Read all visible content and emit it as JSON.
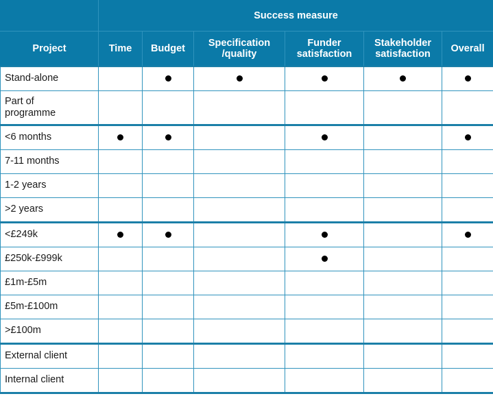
{
  "table": {
    "group_header": "Success measure",
    "columns": [
      {
        "key": "project",
        "label": "Project"
      },
      {
        "key": "time",
        "label": "Time"
      },
      {
        "key": "budget",
        "label": "Budget"
      },
      {
        "key": "spec",
        "label": "Specification\n/quality"
      },
      {
        "key": "funder",
        "label": "Funder\nsatisfaction"
      },
      {
        "key": "stakeholder",
        "label": "Stakeholder\nsatisfaction"
      },
      {
        "key": "overall",
        "label": "Overall"
      }
    ],
    "marker": "●",
    "colors": {
      "header_background": "#0b7aa8",
      "header_text": "#ffffff",
      "grid_line": "#2f93bd",
      "group_rule": "#1b7fa8",
      "marker": "#000000",
      "cell_background": "#ffffff"
    },
    "rows": [
      {
        "label": "Stand-alone",
        "group_start": false,
        "tall": false,
        "marks": {
          "time": false,
          "budget": true,
          "spec": true,
          "funder": true,
          "stakeholder": true,
          "overall": true
        }
      },
      {
        "label": "Part of\nprogramme",
        "group_start": false,
        "tall": true,
        "marks": {
          "time": false,
          "budget": false,
          "spec": false,
          "funder": false,
          "stakeholder": false,
          "overall": false
        }
      },
      {
        "label": "<6 months",
        "group_start": true,
        "tall": false,
        "marks": {
          "time": true,
          "budget": true,
          "spec": false,
          "funder": true,
          "stakeholder": false,
          "overall": true
        }
      },
      {
        "label": "7-11 months",
        "group_start": false,
        "tall": false,
        "marks": {
          "time": false,
          "budget": false,
          "spec": false,
          "funder": false,
          "stakeholder": false,
          "overall": false
        }
      },
      {
        "label": "1-2 years",
        "group_start": false,
        "tall": false,
        "marks": {
          "time": false,
          "budget": false,
          "spec": false,
          "funder": false,
          "stakeholder": false,
          "overall": false
        }
      },
      {
        "label": ">2 years",
        "group_start": false,
        "tall": false,
        "marks": {
          "time": false,
          "budget": false,
          "spec": false,
          "funder": false,
          "stakeholder": false,
          "overall": false
        }
      },
      {
        "label": "<£249k",
        "group_start": true,
        "tall": false,
        "marks": {
          "time": true,
          "budget": true,
          "spec": false,
          "funder": true,
          "stakeholder": false,
          "overall": true
        }
      },
      {
        "label": "£250k-£999k",
        "group_start": false,
        "tall": false,
        "marks": {
          "time": false,
          "budget": false,
          "spec": false,
          "funder": true,
          "stakeholder": false,
          "overall": false
        }
      },
      {
        "label": "£1m-£5m",
        "group_start": false,
        "tall": false,
        "marks": {
          "time": false,
          "budget": false,
          "spec": false,
          "funder": false,
          "stakeholder": false,
          "overall": false
        }
      },
      {
        "label": "£5m-£100m",
        "group_start": false,
        "tall": false,
        "marks": {
          "time": false,
          "budget": false,
          "spec": false,
          "funder": false,
          "stakeholder": false,
          "overall": false
        }
      },
      {
        "label": ">£100m",
        "group_start": false,
        "tall": false,
        "marks": {
          "time": false,
          "budget": false,
          "spec": false,
          "funder": false,
          "stakeholder": false,
          "overall": false
        }
      },
      {
        "label": "External client",
        "group_start": true,
        "tall": false,
        "marks": {
          "time": false,
          "budget": false,
          "spec": false,
          "funder": false,
          "stakeholder": false,
          "overall": false
        }
      },
      {
        "label": "Internal client",
        "group_start": false,
        "tall": false,
        "marks": {
          "time": false,
          "budget": false,
          "spec": false,
          "funder": false,
          "stakeholder": false,
          "overall": false
        }
      }
    ]
  }
}
